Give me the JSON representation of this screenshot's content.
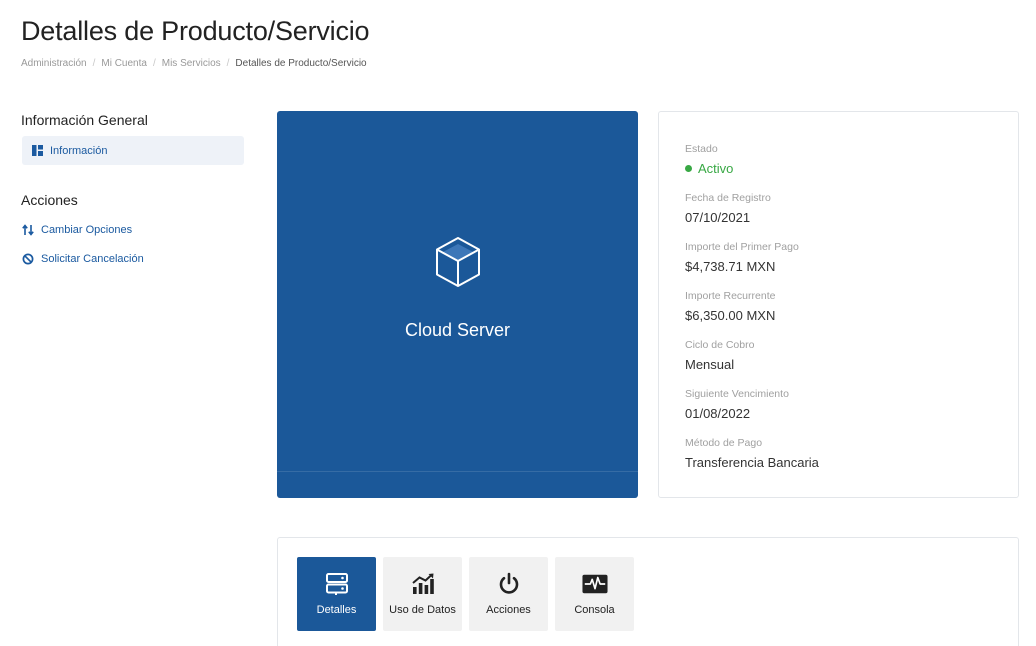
{
  "header": {
    "title": "Detalles de Producto/Servicio",
    "breadcrumb": [
      "Administración",
      "Mi Cuenta",
      "Mis Servicios",
      "Detalles de Producto/Servicio"
    ]
  },
  "sidebar": {
    "general_heading": "Información General",
    "info_item": "Información",
    "actions_heading": "Acciones",
    "actions": [
      {
        "label": "Cambiar Opciones",
        "icon": "arrows-up-down-icon"
      },
      {
        "label": "Solicitar Cancelación",
        "icon": "ban-icon"
      }
    ]
  },
  "product": {
    "name": "Cloud Server",
    "icon": "cube-icon",
    "color": "#1b5899"
  },
  "details": {
    "status_label": "Estado",
    "status_value": "Activo",
    "status_color": "#38a844",
    "items": [
      {
        "label": "Fecha de Registro",
        "value": "07/10/2021"
      },
      {
        "label": "Importe del Primer Pago",
        "value": "$4,738.71 MXN"
      },
      {
        "label": "Importe Recurrente",
        "value": "$6,350.00 MXN"
      },
      {
        "label": "Ciclo de Cobro",
        "value": "Mensual"
      },
      {
        "label": "Siguiente Vencimiento",
        "value": "01/08/2022"
      },
      {
        "label": "Método de Pago",
        "value": "Transferencia Bancaria"
      }
    ]
  },
  "tabs": [
    {
      "label": "Detalles",
      "icon": "server-icon",
      "active": true
    },
    {
      "label": "Uso de Datos",
      "icon": "chart-icon",
      "active": false
    },
    {
      "label": "Acciones",
      "icon": "power-icon",
      "active": false
    },
    {
      "label": "Consola",
      "icon": "console-icon",
      "active": false
    }
  ]
}
